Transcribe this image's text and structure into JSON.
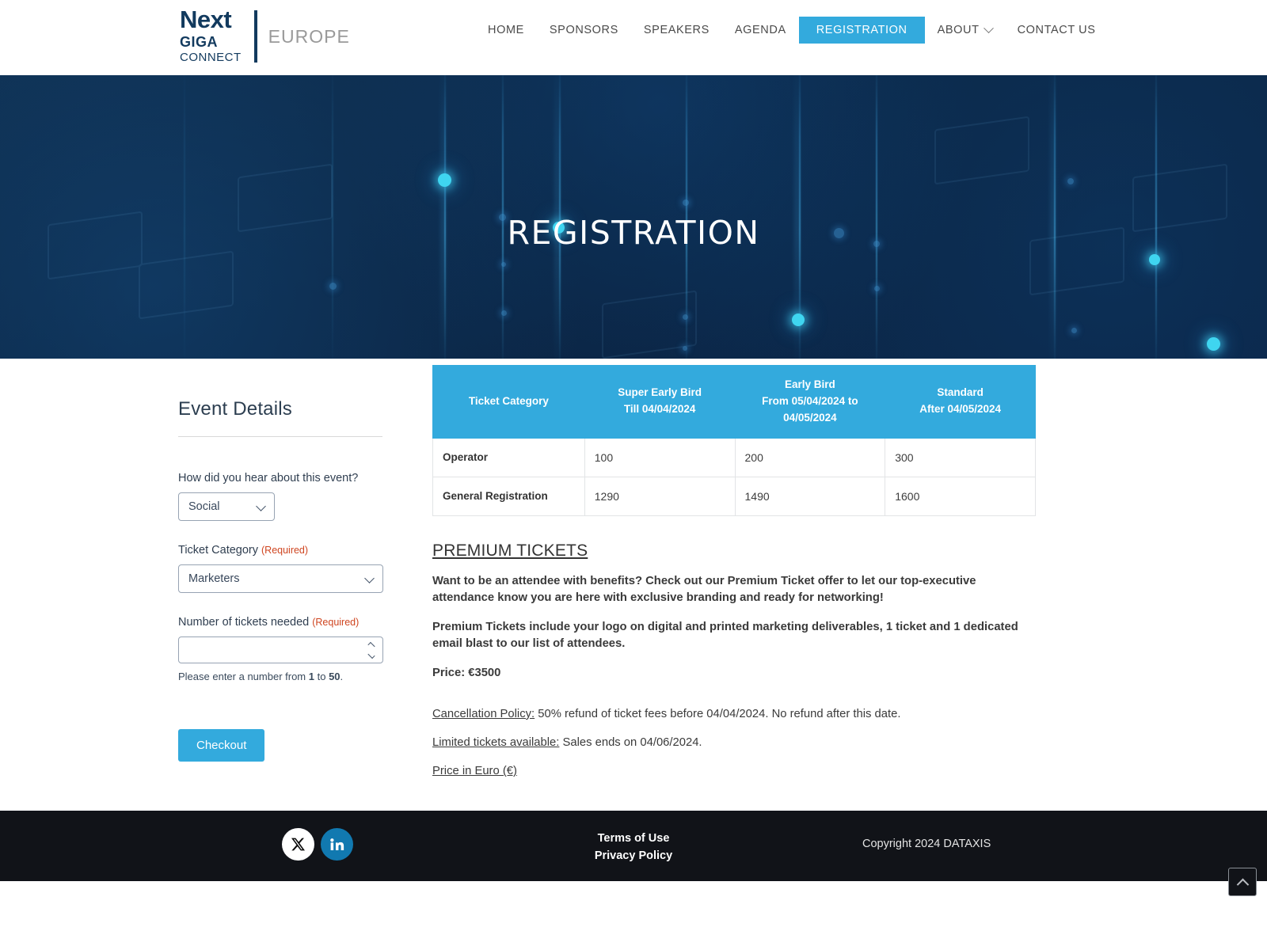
{
  "header": {
    "logo": {
      "line1": "Next",
      "line2": "GIGA",
      "line3": "CONNECT",
      "region": "EUROPE"
    },
    "nav": [
      {
        "label": "HOME",
        "active": false,
        "has_dropdown": false
      },
      {
        "label": "SPONSORS",
        "active": false,
        "has_dropdown": false
      },
      {
        "label": "SPEAKERS",
        "active": false,
        "has_dropdown": false
      },
      {
        "label": "AGENDA",
        "active": false,
        "has_dropdown": false
      },
      {
        "label": "REGISTRATION",
        "active": true,
        "has_dropdown": false
      },
      {
        "label": "ABOUT",
        "active": false,
        "has_dropdown": true
      },
      {
        "label": "CONTACT US",
        "active": false,
        "has_dropdown": false
      }
    ]
  },
  "hero": {
    "title": "REGISTRATION"
  },
  "form": {
    "heading": "Event Details",
    "referral": {
      "label": "How did you hear about this event?",
      "value": "Social",
      "options": [
        "Social"
      ]
    },
    "ticket_category": {
      "label": "Ticket Category",
      "required_text": "(Required)",
      "value": "Marketers",
      "options": [
        "Marketers"
      ]
    },
    "ticket_count": {
      "label": "Number of tickets needed",
      "required_text": "(Required)",
      "value": "",
      "placeholder": "",
      "help_prefix": "Please enter a number from ",
      "help_min": "1",
      "help_mid": " to ",
      "help_max": "50",
      "help_suffix": "."
    },
    "checkout_label": "Checkout"
  },
  "pricing_table": {
    "headers": [
      {
        "line1": "Ticket Category",
        "line2": ""
      },
      {
        "line1": "Super Early Bird",
        "line2": "Till 04/04/2024"
      },
      {
        "line1": "Early Bird",
        "line2": "From 05/04/2024 to 04/05/2024"
      },
      {
        "line1": "Standard",
        "line2": "After 04/05/2024"
      }
    ],
    "rows": [
      {
        "category": "Operator",
        "super_early_bird": "100",
        "early_bird": "200",
        "standard": "300"
      },
      {
        "category": "General Registration",
        "super_early_bird": "1290",
        "early_bird": "1490",
        "standard": "1600"
      }
    ]
  },
  "premium": {
    "title": "PREMIUM TICKETS",
    "paragraph1": "Want to be an attendee with benefits? Check out our Premium Ticket offer to let our top-executive attendance know you are here with exclusive branding and ready for networking!",
    "paragraph2": "Premium Tickets include your logo on digital and printed marketing deliverables, 1 ticket and 1 dedicated email blast to our list of attendees.",
    "price": "Price: €3500"
  },
  "policy": {
    "cancellation_label": "Cancellation Policy:",
    "cancellation_text": " 50% refund of ticket fees before 04/04/2024. No refund after this date.",
    "limited_label": "Limited tickets available:",
    "limited_text": " Sales ends on 04/06/2024.",
    "currency_note": "Price in Euro (€)"
  },
  "footer": {
    "social": [
      {
        "name": "x-twitter",
        "label": "X"
      },
      {
        "name": "linkedin",
        "label": "in"
      }
    ],
    "links": [
      {
        "label": "Terms of Use"
      },
      {
        "label": "Privacy Policy"
      }
    ],
    "copyright": "Copyright 2024 DATAXIS"
  },
  "colors": {
    "accent_blue": "#33AADD",
    "navy": "#123A5E",
    "hero_dark": "#0b2543",
    "required_red": "#cf4520",
    "footer_black": "#111318",
    "linkedin_blue": "#1179B0"
  }
}
